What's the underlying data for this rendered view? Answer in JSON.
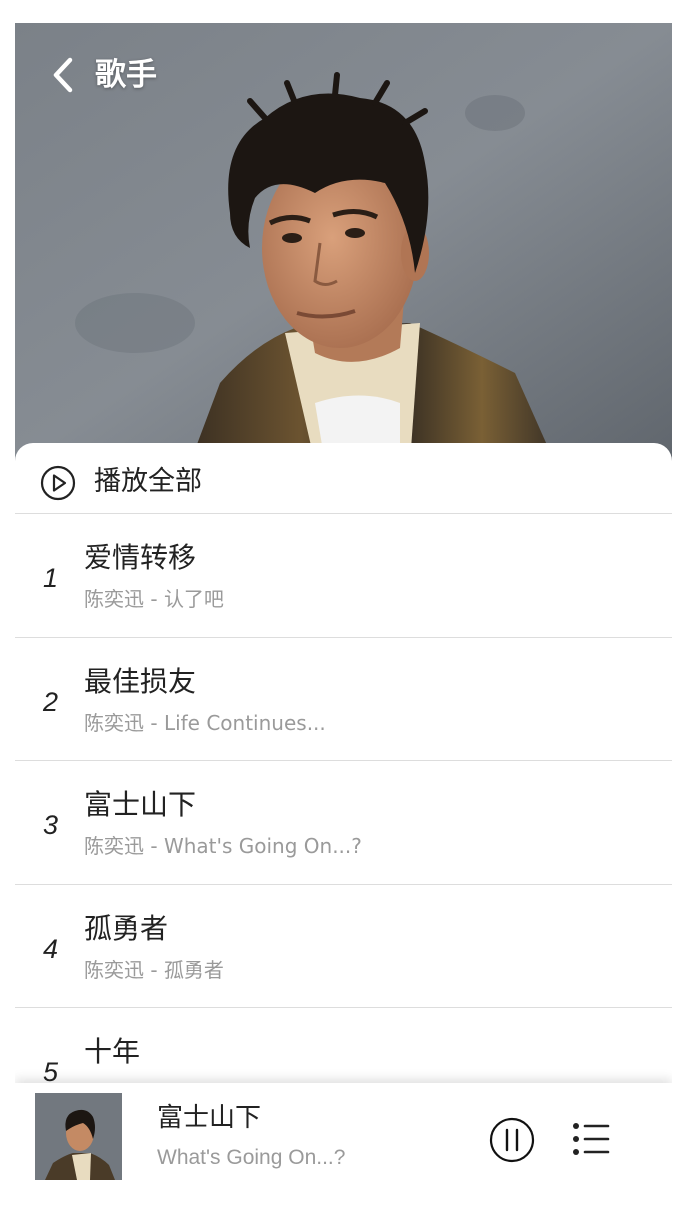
{
  "header": {
    "title": "歌手",
    "back_icon": "chevron-left-icon"
  },
  "play_all": {
    "label": "播放全部",
    "icon": "play-circle-icon"
  },
  "songs": [
    {
      "index": "1",
      "title": "爱情转移",
      "artist": "陈奕迅",
      "separator": " - ",
      "album": "认了吧"
    },
    {
      "index": "2",
      "title": "最佳损友",
      "artist": "陈奕迅",
      "separator": " - ",
      "album": "Life Continues..."
    },
    {
      "index": "3",
      "title": "富士山下",
      "artist": "陈奕迅",
      "separator": " - ",
      "album": "What's Going On...?"
    },
    {
      "index": "4",
      "title": "孤勇者",
      "artist": "陈奕迅",
      "separator": " - ",
      "album": "孤勇者"
    },
    {
      "index": "5",
      "title": "十年",
      "artist": "",
      "separator": "",
      "album": ""
    }
  ],
  "player": {
    "title": "富士山下",
    "subtitle": "What's Going On...?",
    "pause_icon": "pause-circle-icon",
    "playlist_icon": "playlist-icon"
  },
  "colors": {
    "text_primary": "#222222",
    "text_secondary": "#9a9a9a",
    "divider": "#dddddd",
    "hero_background": "#6f757c"
  }
}
